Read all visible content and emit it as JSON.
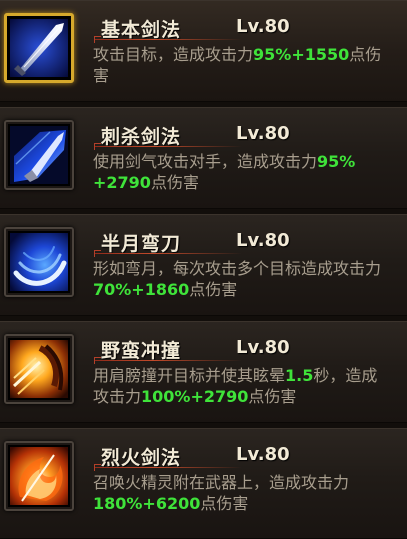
{
  "skills": [
    {
      "name": "基本剑法",
      "level": "Lv.80",
      "selected": true,
      "icon": "sword-slash-icon",
      "desc": [
        {
          "t": "攻击目标，造成攻击力",
          "hl": false
        },
        {
          "t": "95%+1550",
          "hl": true
        },
        {
          "t": "点伤害",
          "hl": false
        }
      ]
    },
    {
      "name": "刺杀剑法",
      "level": "Lv.80",
      "selected": false,
      "icon": "sword-thrust-icon",
      "desc": [
        {
          "t": "使用剑气攻击对手，造成攻击力",
          "hl": false
        },
        {
          "t": "95%",
          "hl": true
        },
        {
          "t": "+2790",
          "hl": true
        },
        {
          "t": "点伤害",
          "hl": false
        }
      ]
    },
    {
      "name": "半月弯刀",
      "level": "Lv.80",
      "selected": false,
      "icon": "crescent-slash-icon",
      "desc": [
        {
          "t": "形如弯月，每次攻击多个目标造成攻击力",
          "hl": false
        },
        {
          "t": "70%+1860",
          "hl": true
        },
        {
          "t": "点伤害",
          "hl": false
        }
      ]
    },
    {
      "name": "野蛮冲撞",
      "level": "Lv.80",
      "selected": false,
      "icon": "shoulder-charge-icon",
      "desc": [
        {
          "t": "用肩膀撞开目标并使其眩晕",
          "hl": false
        },
        {
          "t": "1.5",
          "hl": true
        },
        {
          "t": "秒，造成攻击力",
          "hl": false
        },
        {
          "t": "100%+2790",
          "hl": true
        },
        {
          "t": "点伤害",
          "hl": false
        }
      ]
    },
    {
      "name": "烈火剑法",
      "level": "Lv.80",
      "selected": false,
      "icon": "fire-sword-icon",
      "desc": [
        {
          "t": "召唤火精灵附在武器上，造成攻击力",
          "hl": false
        },
        {
          "t": "180%+6200",
          "hl": true
        },
        {
          "t": "点伤害",
          "hl": false
        }
      ]
    }
  ],
  "colors": {
    "name": "#f2ead6",
    "desc": "#a89e8e",
    "highlight": "#3fe33a",
    "selected_border": "#d6a92c"
  }
}
